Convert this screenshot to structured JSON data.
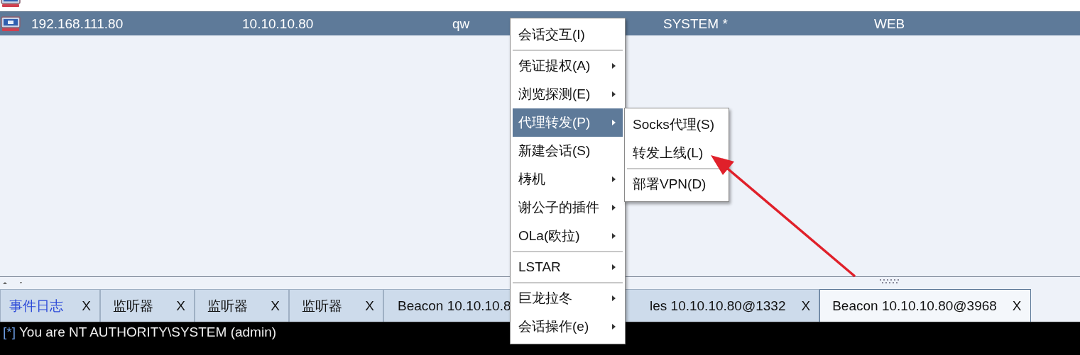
{
  "sessions": {
    "rows": [
      {
        "selected": false
      },
      {
        "selected": true,
        "cells": [
          "192.168.111.80",
          "10.10.10.80",
          "qw",
          "SYSTEM *",
          "WEB"
        ]
      }
    ]
  },
  "context_menu": {
    "items": [
      {
        "kind": "item",
        "label": "会话交互(I)",
        "submenu": false,
        "selected": false
      },
      {
        "kind": "separator"
      },
      {
        "kind": "item",
        "label": "凭证提权(A)",
        "submenu": true,
        "selected": false
      },
      {
        "kind": "item",
        "label": "浏览探测(E)",
        "submenu": true,
        "selected": false
      },
      {
        "kind": "item",
        "label": "代理转发(P)",
        "submenu": true,
        "selected": true
      },
      {
        "kind": "item",
        "label": "新建会话(S)",
        "submenu": false,
        "selected": false
      },
      {
        "kind": "item",
        "label": "梼机",
        "submenu": true,
        "selected": false
      },
      {
        "kind": "item",
        "label": "谢公子的插件",
        "submenu": true,
        "selected": false
      },
      {
        "kind": "item",
        "label": "OLa(欧拉)",
        "submenu": true,
        "selected": false
      },
      {
        "kind": "separator"
      },
      {
        "kind": "item",
        "label": "LSTAR",
        "submenu": true,
        "selected": false
      },
      {
        "kind": "separator"
      },
      {
        "kind": "item",
        "label": "巨龙拉冬",
        "submenu": true,
        "selected": false
      },
      {
        "kind": "item",
        "label": "会话操作(e)",
        "submenu": true,
        "selected": false
      }
    ]
  },
  "submenu": {
    "items": [
      {
        "kind": "item",
        "label": "Socks代理(S)"
      },
      {
        "kind": "item",
        "label": "转发上线(L)"
      },
      {
        "kind": "separator"
      },
      {
        "kind": "item",
        "label": "部署VPN(D)"
      }
    ]
  },
  "tabs": [
    {
      "label": "事件日志",
      "close": "X",
      "alert": true,
      "selected": false
    },
    {
      "label": "监听器",
      "close": "X",
      "alert": false,
      "selected": false
    },
    {
      "label": "监听器",
      "close": "X",
      "alert": false,
      "selected": false
    },
    {
      "label": "监听器",
      "close": "X",
      "alert": false,
      "selected": false
    },
    {
      "label": "Beacon 10.10.10.8",
      "alert": false,
      "selected": false
    },
    {
      "label": "les 10.10.10.80@1332",
      "close": "X",
      "alert": false,
      "selected": false,
      "covered": true
    },
    {
      "label": "Beacon 10.10.10.80@3968",
      "close": "X",
      "alert": false,
      "selected": true
    }
  ],
  "console": {
    "lines": [
      {
        "marker": "[*]",
        "text": "You are NT AUTHORITY\\SYSTEM (admin)"
      }
    ]
  }
}
